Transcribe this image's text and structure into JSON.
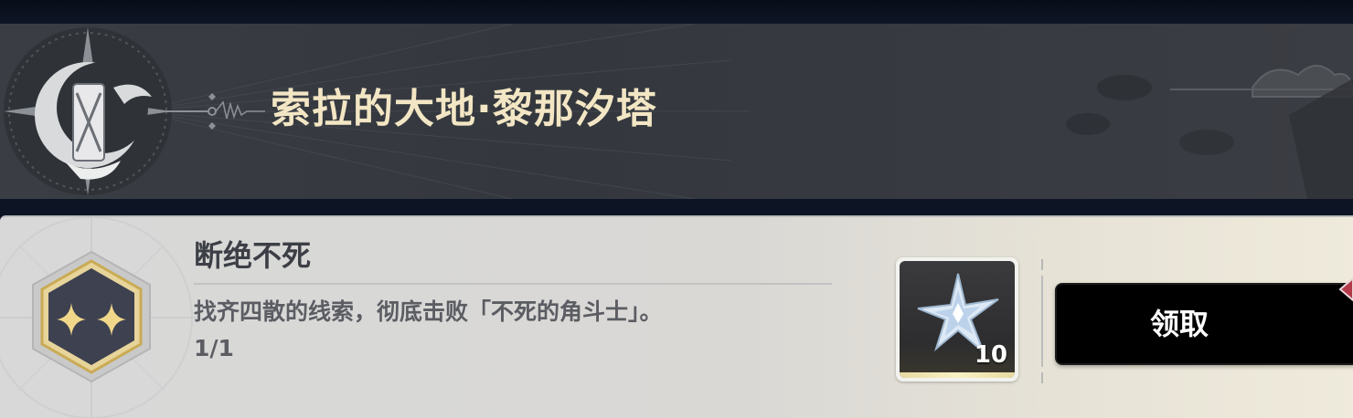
{
  "banner": {
    "title": "索拉的大地·黎那汐塔",
    "emblem_icon": "moon-lantern-crest-icon"
  },
  "achievement": {
    "title": "断绝不死",
    "description": "找齐四散的线索，彻底击败「不死的角斗士」。",
    "progress": "1/1",
    "badge_icon": "two-stars-hexagon-icon"
  },
  "reward": {
    "item_icon": "crystal-star-icon",
    "count": "10"
  },
  "claim_button": {
    "label": "领取",
    "notification_icon": "red-diamond-dot-icon"
  },
  "colors": {
    "title_gold": "#f3e6c4",
    "banner_bg": "#373b41",
    "card_bg": "#d8d8d8",
    "button_bg": "#000000",
    "badge_gold": "#c9ab55"
  }
}
